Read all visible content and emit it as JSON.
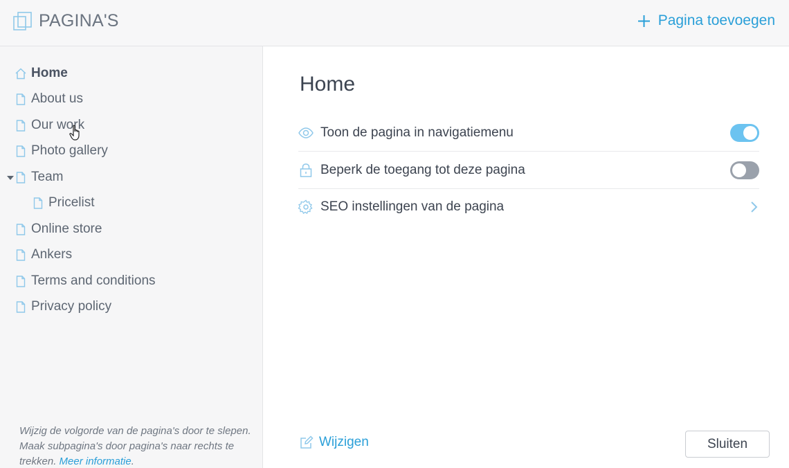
{
  "header": {
    "title": "PAGINA'S",
    "add_page_label": "Pagina toevoegen",
    "icons": {
      "title_icon": "pages-stack-icon",
      "add_icon": "plus-icon"
    }
  },
  "sidebar": {
    "items": [
      {
        "label": "Home",
        "icon": "home-icon",
        "active": true,
        "level": 0
      },
      {
        "label": "About us",
        "icon": "page-icon",
        "level": 0
      },
      {
        "label": "Our work",
        "icon": "page-icon",
        "level": 0
      },
      {
        "label": "Photo gallery",
        "icon": "page-icon",
        "level": 0
      },
      {
        "label": "Team",
        "icon": "page-icon",
        "level": 0,
        "expanded": true
      },
      {
        "label": "Pricelist",
        "icon": "page-icon",
        "level": 1
      },
      {
        "label": "Online store",
        "icon": "page-icon",
        "level": 0
      },
      {
        "label": "Ankers",
        "icon": "page-icon",
        "level": 0
      },
      {
        "label": "Terms and conditions",
        "icon": "page-icon",
        "level": 0
      },
      {
        "label": "Privacy policy",
        "icon": "page-icon",
        "level": 0
      }
    ],
    "note_text": "Wijzig de volgorde van de pagina's door te slepen. Maak subpagina's door pagina's naar rechts te trekken.",
    "note_link": "Meer informatie",
    "note_end": "."
  },
  "main": {
    "title": "Home",
    "settings": [
      {
        "label": "Toon de pagina in navigatiemenu",
        "icon": "eye-icon",
        "control": "toggle",
        "on": true
      },
      {
        "label": "Beperk de toegang tot deze pagina",
        "icon": "lock-icon",
        "control": "toggle",
        "on": false
      },
      {
        "label": "SEO instellingen van de pagina",
        "icon": "gear-icon",
        "control": "chevron"
      }
    ],
    "edit_label": "Wijzigen",
    "close_label": "Sluiten"
  },
  "colors": {
    "accent": "#2a9fd8",
    "toggle_on": "#6cc3f0",
    "toggle_off": "#9aa1ab",
    "icon": "#8fc8ea"
  }
}
